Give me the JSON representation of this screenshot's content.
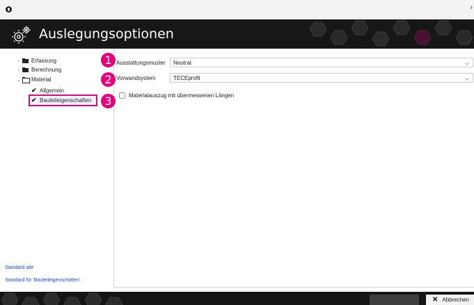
{
  "window": {
    "close_glyph": "›"
  },
  "header": {
    "title": "Auslegungsoptionen",
    "icon": "gears-icon"
  },
  "tree": {
    "items": [
      {
        "label": "Erfassung",
        "caret": "›",
        "icon": "folder-icon"
      },
      {
        "label": "Berechnung",
        "caret": "›",
        "icon": "folder-icon"
      },
      {
        "label": "Material",
        "caret": "⌄",
        "icon": "folder-open-icon"
      },
      {
        "label": "Allgemein",
        "icon": "check-icon"
      },
      {
        "label": "Bauteileigenschaften",
        "icon": "check-icon",
        "selected": true
      }
    ]
  },
  "callouts": [
    "1",
    "2",
    "3"
  ],
  "links": {
    "standard_all": "Standard alle",
    "standard_for": "Standard für 'Bauteileigenschaften'"
  },
  "form": {
    "ausstattungsmuster": {
      "label": "Ausstattungsmuster",
      "value": "Neutral"
    },
    "vorwandsystem": {
      "label": "Vorwandsystem",
      "value": "TECEprofil"
    },
    "materialauszug": {
      "label": "Materialauszug mit übermessenen Längen",
      "checked": false
    }
  },
  "footer": {
    "cancel_label": "Abbrechen"
  },
  "colors": {
    "accent": "#e2007a",
    "header_bg": "#171717",
    "link": "#1a4fc4"
  }
}
